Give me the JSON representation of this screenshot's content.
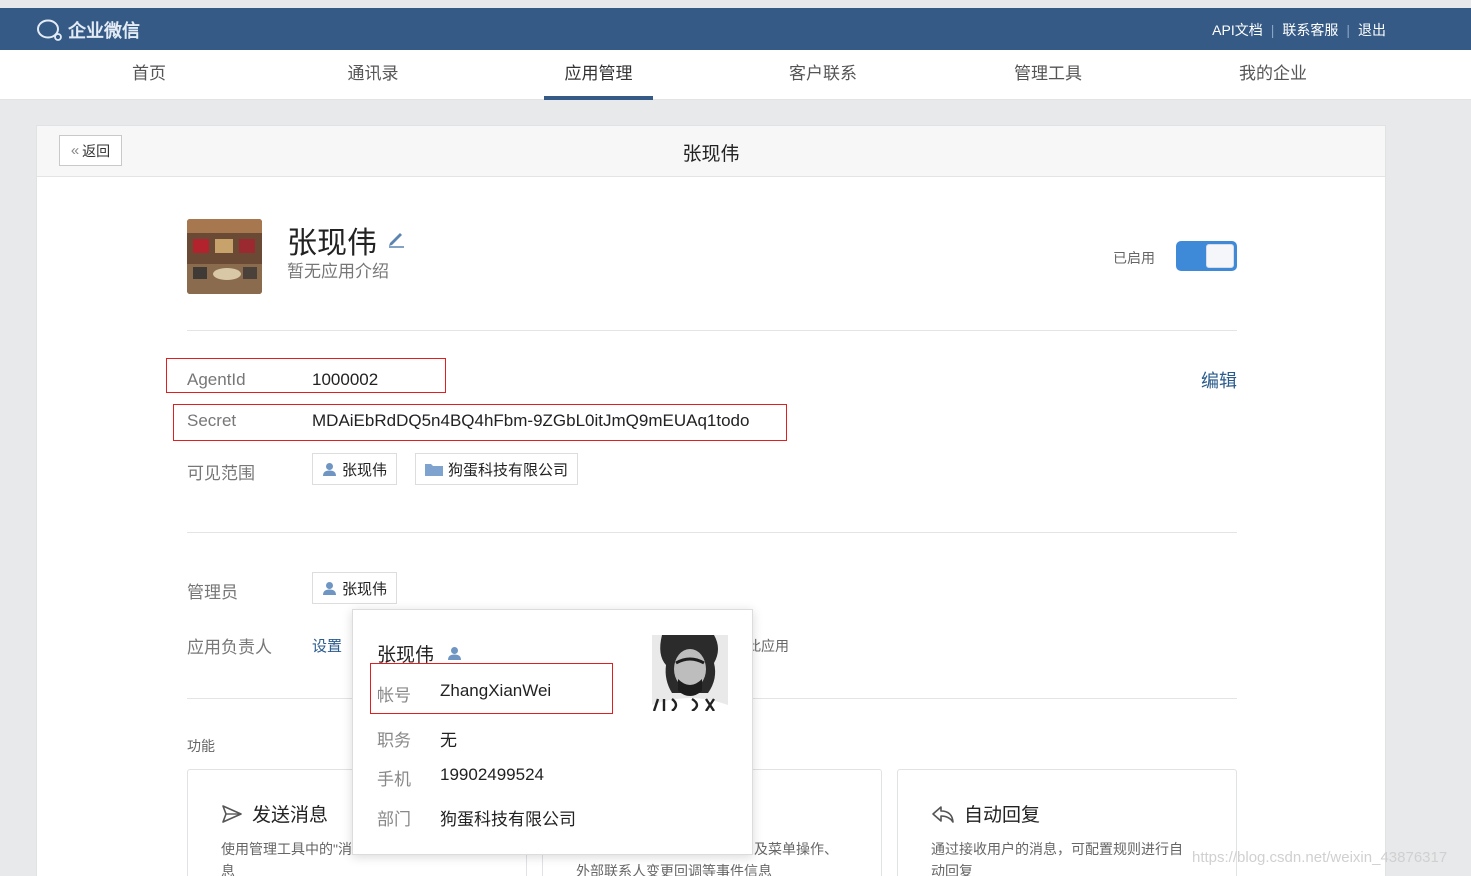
{
  "topbar": {
    "logo_text": "企业微信",
    "links": [
      "API文档",
      "联系客服",
      "退出"
    ]
  },
  "nav": {
    "items": [
      "首页",
      "通讯录",
      "应用管理",
      "客户联系",
      "管理工具",
      "我的企业"
    ],
    "active": "应用管理"
  },
  "header": {
    "back_label": "返回",
    "title": "张现伟"
  },
  "app": {
    "name": "张现伟",
    "intro": "暂无应用介绍",
    "status_label": "已启用",
    "enabled": true
  },
  "details": {
    "agentid_label": "AgentId",
    "agentid_value": "1000002",
    "secret_label": "Secret",
    "secret_value": "MDAiEbRdDQ5n4BQ4hFbm-9ZGbL0itJmQ9mEUAq1todo",
    "edit_label": "编辑",
    "visibility_label": "可见范围",
    "visibility_items": [
      "张现伟",
      "狗蛋科技有限公司"
    ]
  },
  "admin": {
    "admin_label": "管理员",
    "admin_user": "张现伟",
    "owner_label": "应用负责人",
    "owner_action": "设置",
    "owner_behind_text": "此应用"
  },
  "features": {
    "label": "功能",
    "cards": [
      {
        "title": "发送消息",
        "desc_line1": "使用管理工具中的\"消",
        "desc_line2": "息"
      },
      {
        "title": "",
        "desc_line1": "及菜单操作、",
        "desc_line2": "外部联系人变更回调等事件信息"
      },
      {
        "title": "自动回复",
        "desc_line1": "通过接收用户的消息，可配置规则进行自",
        "desc_line2": "动回复"
      }
    ]
  },
  "popover": {
    "name": "张现伟",
    "account_label": "帐号",
    "account_value": "ZhangXianWei",
    "title_label": "职务",
    "title_value": "无",
    "phone_label": "手机",
    "phone_value": "19902499524",
    "dept_label": "部门",
    "dept_value": "狗蛋科技有限公司"
  },
  "watermark": "https://blog.csdn.net/weixin_43876317",
  "colors": {
    "topbar": "#355a86",
    "accent": "#3e8ad9",
    "highlight_box": "#e02020",
    "link": "#2b5b8c"
  }
}
